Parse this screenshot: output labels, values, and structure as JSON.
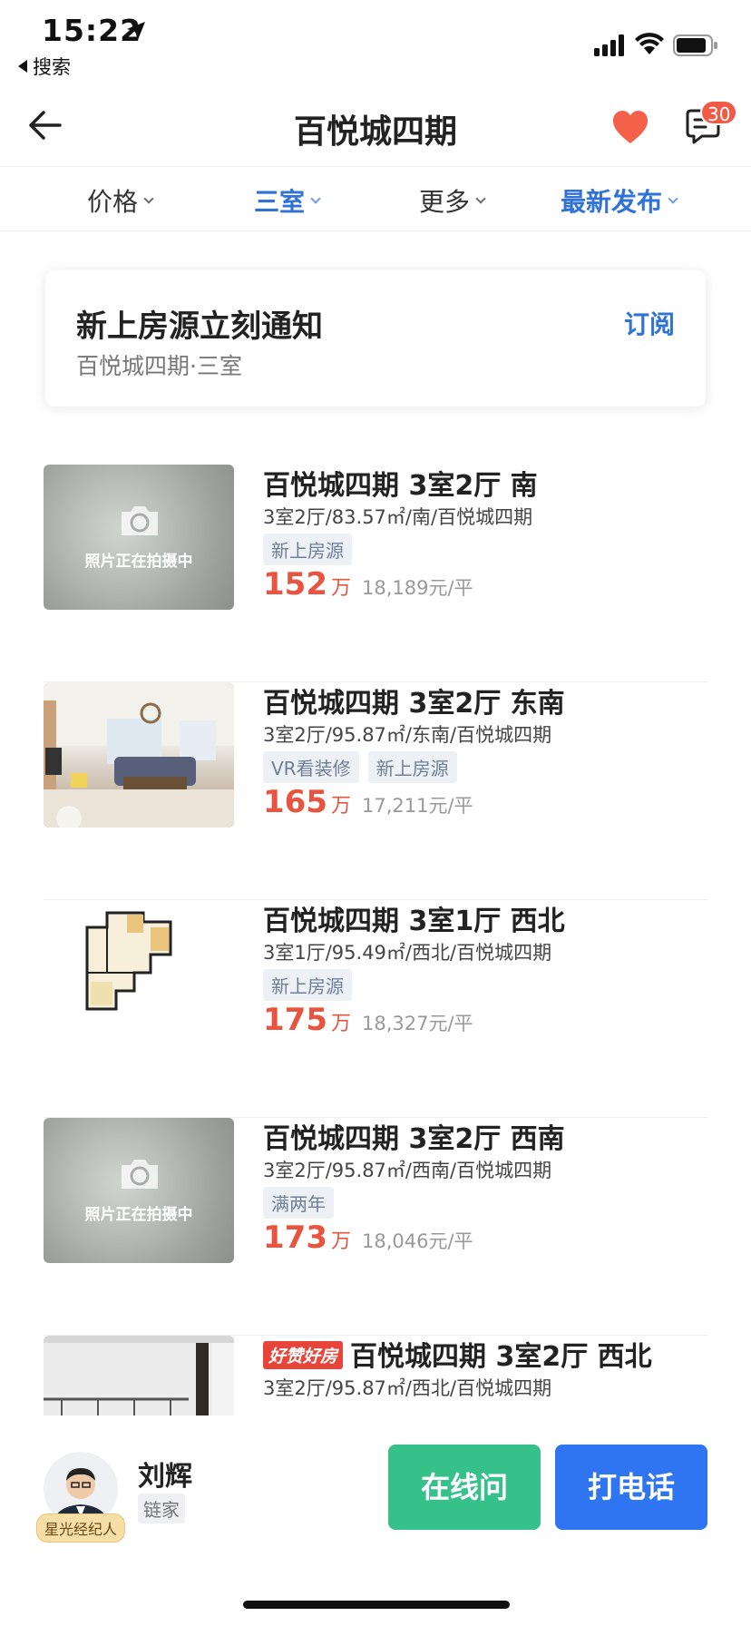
{
  "status_bar": {
    "time": "15:22",
    "back_app": "搜索"
  },
  "nav": {
    "title": "百悦城四期",
    "badge_count": "30"
  },
  "filters": [
    {
      "label": "价格",
      "active": false
    },
    {
      "label": "三室",
      "active": true
    },
    {
      "label": "更多",
      "active": false
    },
    {
      "label": "最新发布",
      "active": true
    }
  ],
  "subscribe": {
    "title": "新上房源立刻通知",
    "subtitle": "百悦城四期·三室",
    "action": "订阅"
  },
  "listings": [
    {
      "title": "百悦城四期 3室2厅 南",
      "desc": "3室2厅/83.57㎡/南/百悦城四期",
      "tags": [
        "新上房源"
      ],
      "price": "152",
      "price_unit": "万",
      "unit_price": "18,189元/平",
      "thumb": "photo-placeholder",
      "thumb_text": "照片正在拍摄中"
    },
    {
      "title": "百悦城四期 3室2厅 东南",
      "desc": "3室2厅/95.87㎡/东南/百悦城四期",
      "tags": [
        "VR看装修",
        "新上房源"
      ],
      "price": "165",
      "price_unit": "万",
      "unit_price": "17,211元/平",
      "thumb": "living-room-photo"
    },
    {
      "title": "百悦城四期 3室1厅 西北",
      "desc": "3室1厅/95.49㎡/西北/百悦城四期",
      "tags": [
        "新上房源"
      ],
      "price": "175",
      "price_unit": "万",
      "unit_price": "18,327元/平",
      "thumb": "floor-plan"
    },
    {
      "title": "百悦城四期 3室2厅 西南",
      "desc": "3室2厅/95.87㎡/西南/百悦城四期",
      "tags": [
        "满两年"
      ],
      "price": "173",
      "price_unit": "万",
      "unit_price": "18,046元/平",
      "thumb": "photo-placeholder",
      "thumb_text": "照片正在拍摄中"
    },
    {
      "badge": "好赞好房",
      "title": "百悦城四期 3室2厅 西北",
      "desc": "3室2厅/95.87㎡/西北/百悦城四期",
      "thumb": "balcony-photo"
    }
  ],
  "agent": {
    "name": "刘辉",
    "company": "链家",
    "badge": "星光经纪人"
  },
  "actions": {
    "online": "在线问",
    "call": "打电话"
  },
  "colors": {
    "accent_blue": "#3072d8",
    "price_red": "#e8543f",
    "online_green": "#37c18a",
    "call_blue": "#2f74f0",
    "heart": "#f4604a"
  }
}
